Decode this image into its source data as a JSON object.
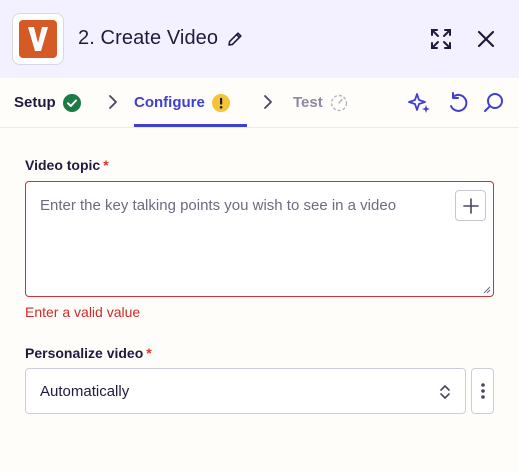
{
  "header": {
    "title": "2. Create Video",
    "app_logo_letter": "V",
    "accent_color": "#d65a25"
  },
  "tabs": [
    {
      "label": "Setup",
      "status": "complete"
    },
    {
      "label": "Configure",
      "status": "warning",
      "active": true
    },
    {
      "label": "Test",
      "status": "pending"
    }
  ],
  "form": {
    "video_topic": {
      "label": "Video topic",
      "required_mark": "*",
      "placeholder": "Enter the key talking points you wish to see in a video",
      "error": "Enter a valid value"
    },
    "personalize_video": {
      "label": "Personalize video",
      "required_mark": "*",
      "value": "Automatically"
    }
  },
  "icons": {
    "setup_status": "check-circle-icon",
    "configure_status": "warning-circle-icon",
    "test_status": "timer-icon",
    "expand": "expand-icon",
    "close": "close-icon",
    "edit": "pencil-icon",
    "ai": "sparkle-icon",
    "undo": "undo-icon",
    "search": "search-icon"
  },
  "colors": {
    "header_bg": "#f3f1ff",
    "active_tab": "#3f3fd0",
    "success": "#1c7a45",
    "warning": "#f3c338",
    "error": "#d12a2a"
  }
}
